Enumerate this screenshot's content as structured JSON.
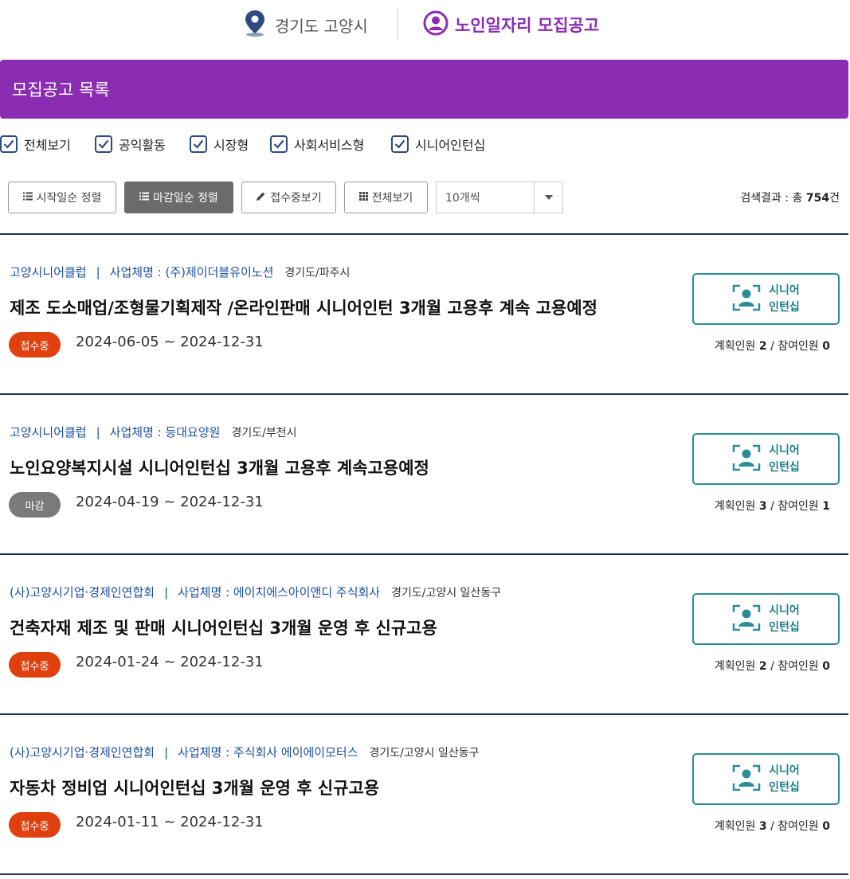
{
  "header": {
    "location": "경기도 고양시",
    "brand": "노인일자리 모집공고"
  },
  "section_title": "모집공고 목록",
  "filters": [
    {
      "label": "전체보기",
      "checked": true
    },
    {
      "label": "공익활동",
      "checked": true
    },
    {
      "label": "시장형",
      "checked": true
    },
    {
      "label": "사회서비스형",
      "checked": true
    },
    {
      "label": "시니어인턴십",
      "checked": true
    }
  ],
  "toolbar": {
    "sort_start": "시작일순 정렬",
    "sort_deadline": "마감일순 정렬",
    "view_open": "접수중보기",
    "view_all": "전체보기",
    "page_size": "10개씩",
    "result_label": "검색결과 : 총",
    "result_count": "754",
    "result_unit": "건"
  },
  "listings": [
    {
      "org": "고양시니어클럽",
      "sep": "|",
      "business": "사업체명 : (주)제이더블유이노션",
      "region": "경기도/파주시",
      "title": "제조 도소매업/조형물기획제작 /온라인판매 시니어인턴 3개월 고용후 계속 고용예정",
      "status": "접수중",
      "dates": "2024-06-05 ~ 2024-12-31",
      "type_line1": "시니어",
      "type_line2": "인턴십",
      "planned_label": "계획인원",
      "planned": "2",
      "slash": "/",
      "joined_label": "참여인원",
      "joined": "0"
    },
    {
      "org": "고양시니어클럽",
      "sep": "|",
      "business": "사업체명 : 등대요양원",
      "region": "경기도/부천시",
      "title": "노인요양복지시설 시니어인턴십 3개월 고용후 계속고용예정",
      "status": "마감",
      "dates": "2024-04-19 ~ 2024-12-31",
      "type_line1": "시니어",
      "type_line2": "인턴십",
      "planned_label": "계획인원",
      "planned": "3",
      "slash": "/",
      "joined_label": "참여인원",
      "joined": "1"
    },
    {
      "org": "(사)고양시기업·경제인연합회",
      "sep": "|",
      "business": "사업체명 : 에이치에스아이앤디 주식회사",
      "region": "경기도/고양시 일산동구",
      "title": "건축자재 제조 및 판매 시니어인턴십 3개월 운영 후 신규고용",
      "status": "접수중",
      "dates": "2024-01-24 ~ 2024-12-31",
      "type_line1": "시니어",
      "type_line2": "인턴십",
      "planned_label": "계획인원",
      "planned": "2",
      "slash": "/",
      "joined_label": "참여인원",
      "joined": "0"
    },
    {
      "org": "(사)고양시기업·경제인연합회",
      "sep": "|",
      "business": "사업체명 : 주식회사 에이에이모터스",
      "region": "경기도/고양시 일산동구",
      "title": "자동차 정비업 시니어인턴십 3개월 운영 후 신규고용",
      "status": "접수중",
      "dates": "2024-01-11 ~ 2024-12-31",
      "type_line1": "시니어",
      "type_line2": "인턴십",
      "planned_label": "계획인원",
      "planned": "3",
      "slash": "/",
      "joined_label": "참여인원",
      "joined": "0"
    }
  ],
  "colors": {
    "brand_purple": "#8a2db3",
    "navy_rule": "#1e3160",
    "link_blue": "#1b4fa0",
    "status_open": "#e0400e",
    "status_closed": "#7a7a7a",
    "teal": "#2a8e98"
  }
}
